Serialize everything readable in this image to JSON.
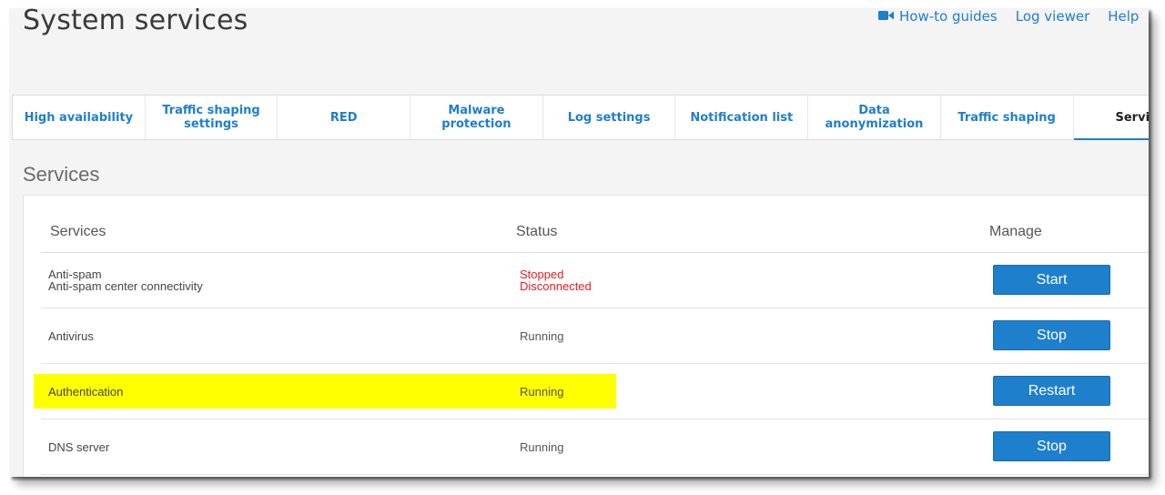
{
  "page": {
    "title": "System services"
  },
  "top_links": [
    {
      "label": "How-to guides",
      "icon": "video-camera-icon"
    },
    {
      "label": "Log viewer"
    },
    {
      "label": "Help"
    }
  ],
  "tabs": [
    {
      "label": "High availability"
    },
    {
      "label": "Traffic shaping settings"
    },
    {
      "label": "RED"
    },
    {
      "label": "Malware protection"
    },
    {
      "label": "Log settings"
    },
    {
      "label": "Notification list"
    },
    {
      "label": "Data anonymization"
    },
    {
      "label": "Traffic shaping"
    },
    {
      "label": "Servic",
      "active": true
    }
  ],
  "services_section": {
    "title": "Services",
    "columns": {
      "services": "Services",
      "status": "Status",
      "manage": "Manage"
    },
    "rows": [
      {
        "name_line1": "Anti-spam",
        "name_line2": "Anti-spam center connectivity",
        "status_line1": "Stopped",
        "status_line2": "Disconnected",
        "action": "Start"
      },
      {
        "name_line1": "Antivirus",
        "status_line1": "Running",
        "action": "Stop"
      },
      {
        "name_line1": "Authentication",
        "status_line1": "Running",
        "action": "Restart",
        "highlighted": true
      },
      {
        "name_line1": "DNS server",
        "status_line1": "Running",
        "action": "Stop"
      }
    ]
  },
  "colors": {
    "accent": "#1f7ecb",
    "button": "#1e7fcc",
    "error": "#ee1c1c",
    "highlight": "#ffff00"
  }
}
